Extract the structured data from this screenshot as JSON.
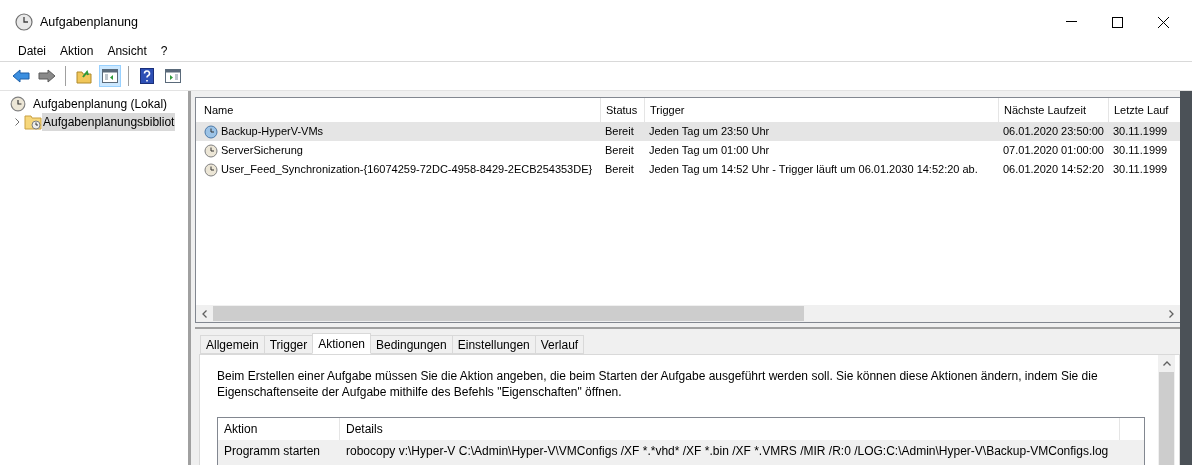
{
  "window": {
    "title": "Aufgabenplanung"
  },
  "menu": [
    {
      "label": "Datei"
    },
    {
      "label": "Aktion"
    },
    {
      "label": "Ansicht"
    },
    {
      "label": "?"
    }
  ],
  "toolbar": [
    [
      {
        "kind": "back",
        "pressed": false
      },
      {
        "kind": "forward",
        "pressed": false
      }
    ],
    [
      {
        "kind": "folder-up",
        "pressed": false
      },
      {
        "kind": "tree-pane",
        "pressed": true
      }
    ],
    [
      {
        "kind": "help",
        "pressed": false
      },
      {
        "kind": "action-pane",
        "pressed": false
      }
    ]
  ],
  "tree": {
    "items": [
      {
        "label": "Aufgabenplanung (Lokal)",
        "selected": false,
        "children": [
          {
            "label": "Aufgabenplanungsbibliot",
            "selected": true,
            "expanded": false
          }
        ]
      }
    ]
  },
  "task_list": {
    "columns": [
      "Name",
      "Status",
      "Trigger",
      "Nächste Laufzeit",
      "Letzte Lauf"
    ],
    "rows": [
      {
        "selected": true,
        "cells": [
          "Backup-HyperV-VMs",
          "Bereit",
          "Jeden Tag um 23:50 Uhr",
          "06.01.2020 23:50:00",
          "30.11.1999"
        ]
      },
      {
        "selected": false,
        "cells": [
          "ServerSicherung",
          "Bereit",
          "Jeden Tag um 01:00 Uhr",
          "07.01.2020 01:00:00",
          "30.11.1999"
        ]
      },
      {
        "selected": false,
        "cells": [
          "User_Feed_Synchronization-{16074259-72DC-4958-8429-2ECB254353DE}",
          "Bereit",
          "Jeden Tag um 14:52 Uhr - Trigger läuft um 06.01.2030 14:52:20 ab.",
          "06.01.2020 14:52:20",
          "30.11.1999"
        ]
      }
    ]
  },
  "details": {
    "tabs": [
      {
        "label": "Allgemein",
        "selected": false
      },
      {
        "label": "Trigger",
        "selected": false
      },
      {
        "label": "Aktionen",
        "selected": true
      },
      {
        "label": "Bedingungen",
        "selected": false
      },
      {
        "label": "Einstellungen",
        "selected": false
      },
      {
        "label": "Verlauf",
        "selected": false
      }
    ],
    "description": "Beim Erstellen einer Aufgabe müssen Sie die Aktion angeben, die beim Starten der Aufgabe ausgeführt werden soll. Sie können diese Aktionen ändern, indem Sie die Eigenschaftenseite der Aufgabe mithilfe des Befehls \"Eigenschaften\" öffnen.",
    "actions_table": {
      "columns": [
        "Aktion",
        "Details"
      ],
      "rows": [
        {
          "selected": true,
          "cells": [
            "Programm starten",
            "robocopy v:\\Hyper-V C:\\Admin\\Hyper-V\\VMConfigs /XF *.*vhd* /XF *.bin /XF *.VMRS /MIR /R:0 /LOG:C:\\Admin\\Hyper-V\\Backup-VMConfigs.log"
          ]
        }
      ]
    }
  }
}
